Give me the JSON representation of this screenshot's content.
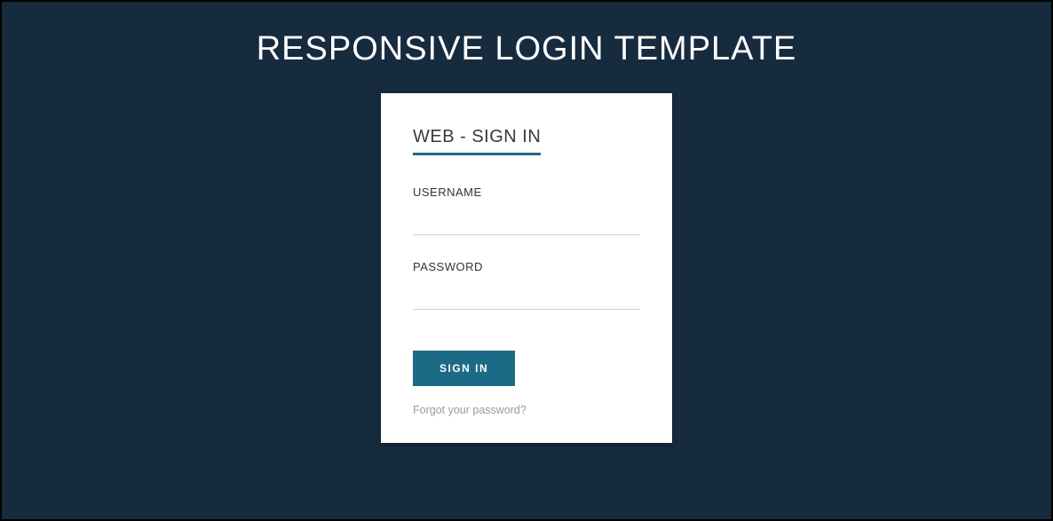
{
  "page": {
    "title": "RESPONSIVE LOGIN TEMPLATE"
  },
  "card": {
    "heading": "WEB - SIGN IN",
    "fields": {
      "username": {
        "label": "USERNAME",
        "value": "",
        "placeholder": ""
      },
      "password": {
        "label": "PASSWORD",
        "value": "",
        "placeholder": ""
      }
    },
    "submit_label": "SIGN IN",
    "forgot_link": "Forgot your password?"
  },
  "colors": {
    "background": "#162b3d",
    "card_bg": "#ffffff",
    "accent": "#1d6a86",
    "text_light": "#ffffff",
    "text_dark": "#333333",
    "muted": "#9a9a9a"
  }
}
